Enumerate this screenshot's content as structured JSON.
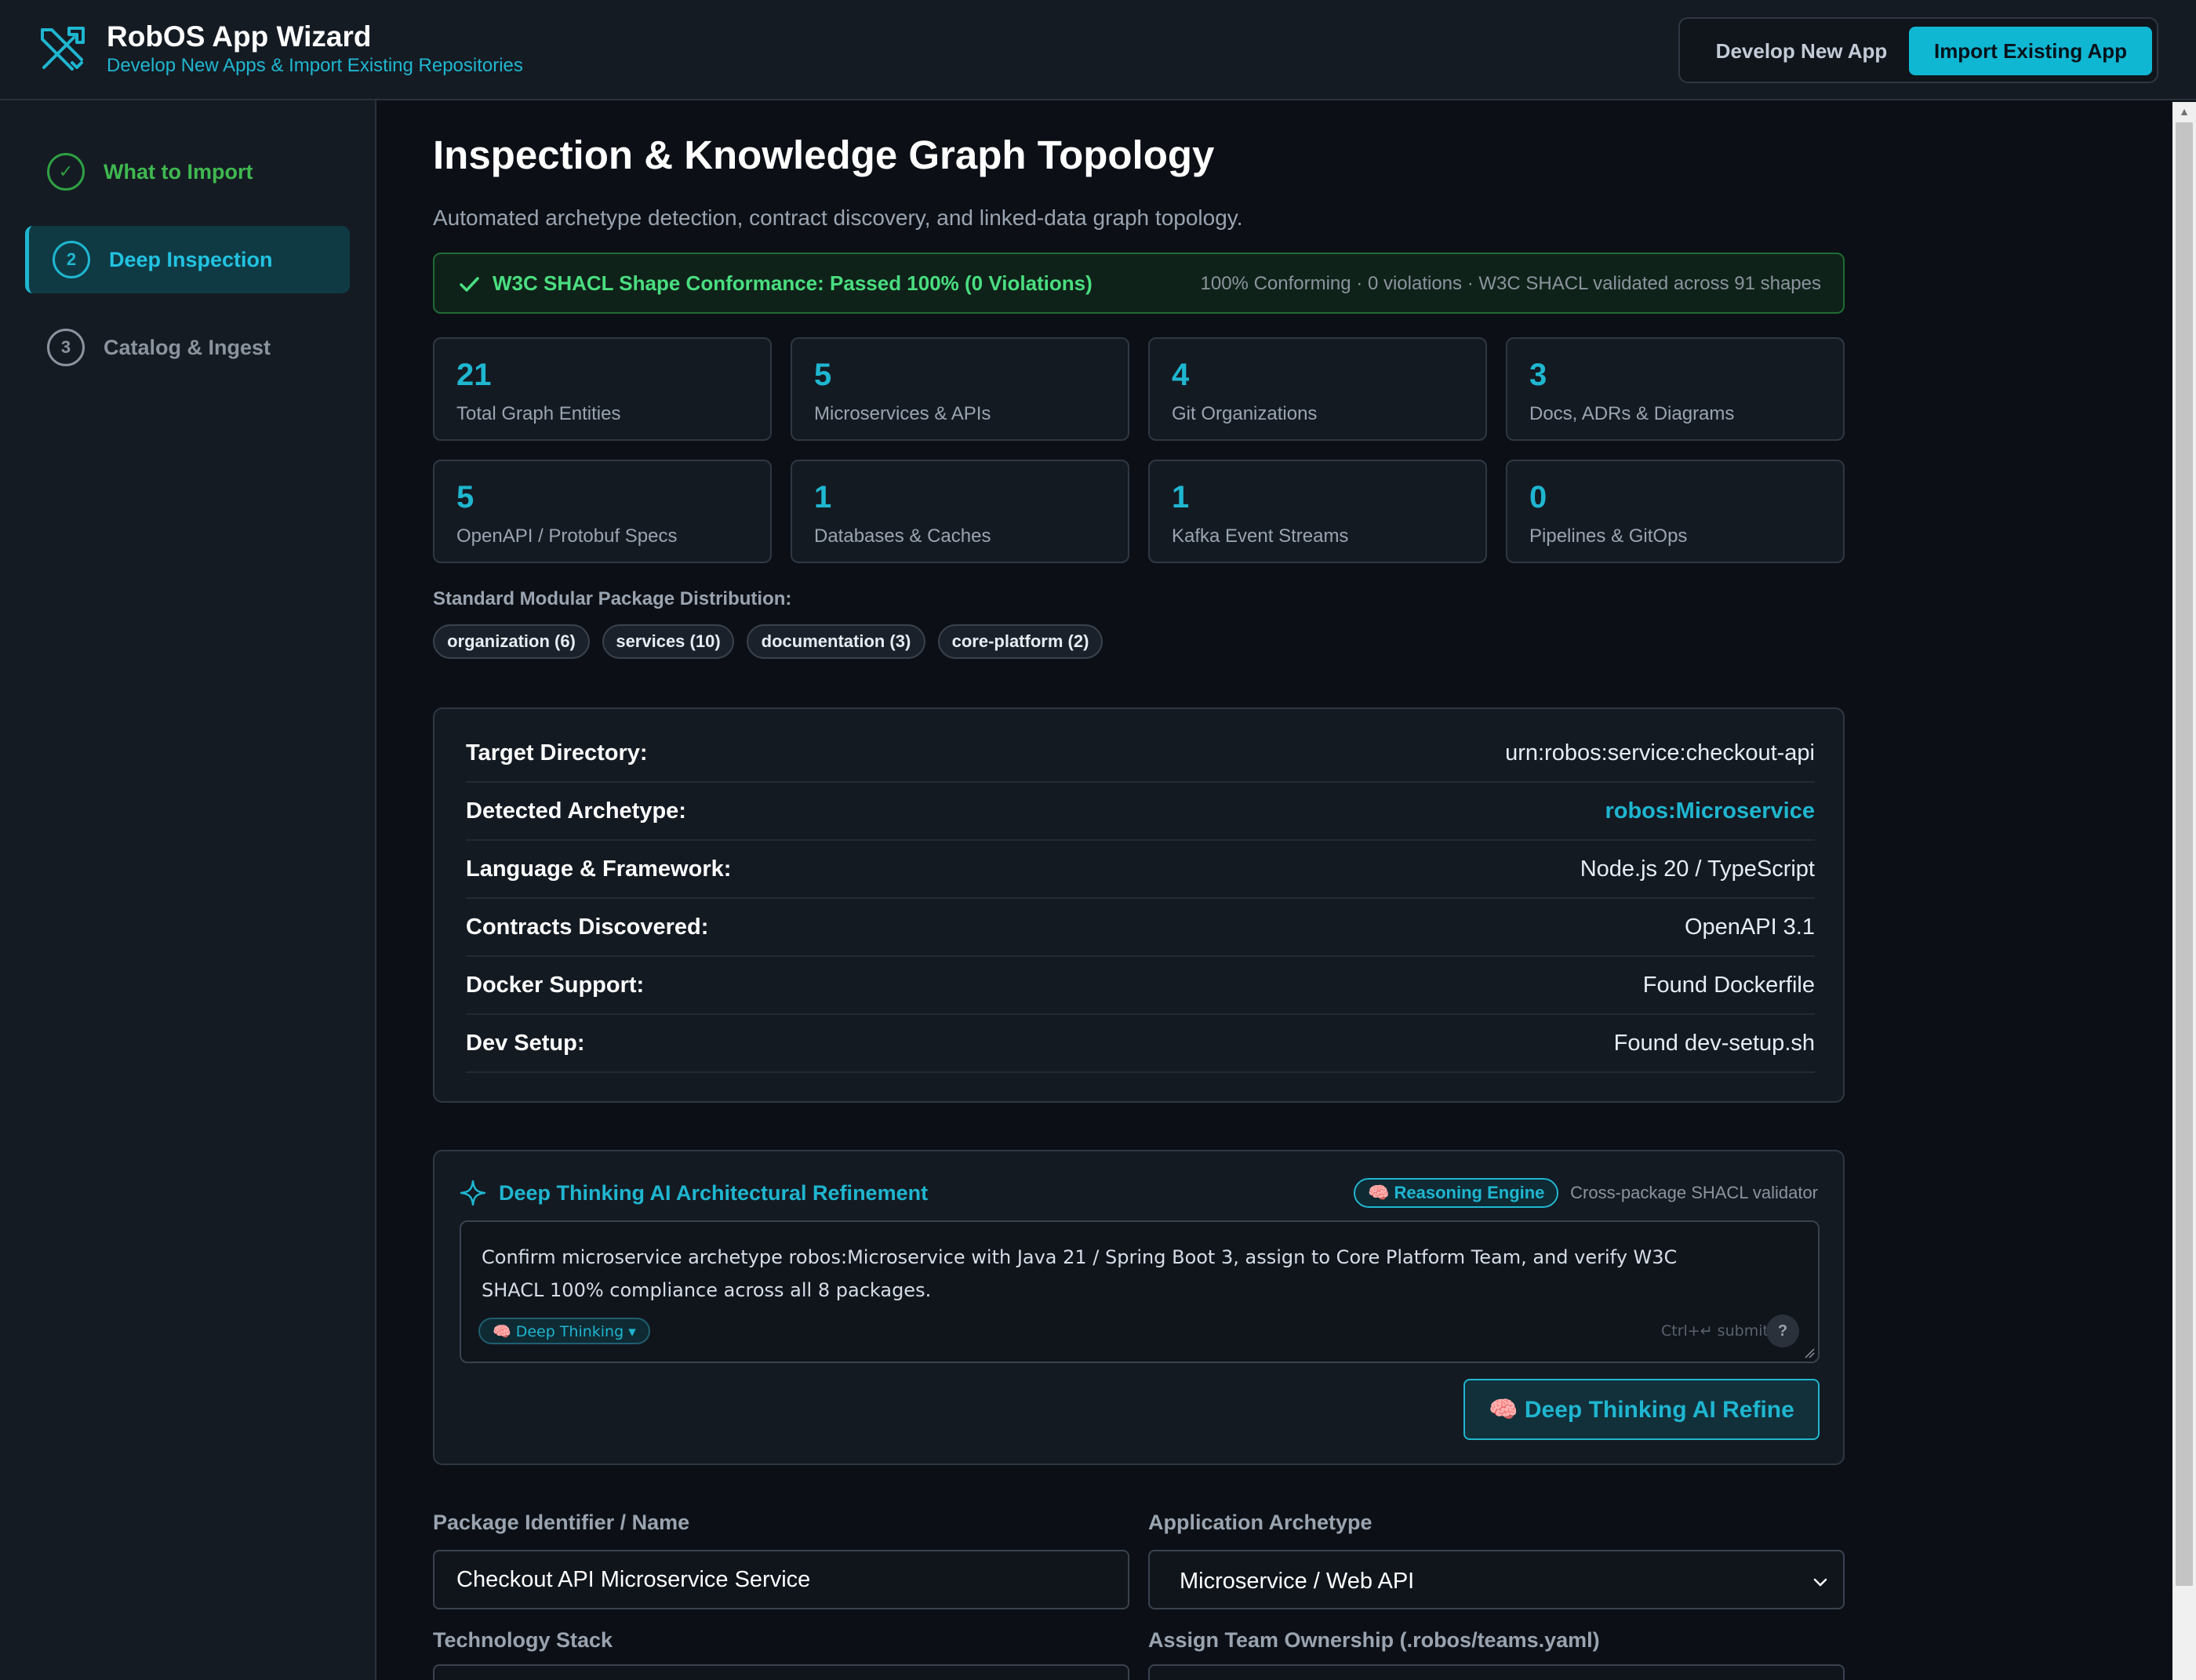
{
  "header": {
    "title": "RobOS App Wizard",
    "subtitle": "Develop New Apps & Import Existing Repositories",
    "logo_icon": "tools-cross-icon",
    "mode_develop_label": "Develop New App",
    "mode_import_label": "Import Existing App",
    "accent_color": "#10b7d3"
  },
  "sidebar": {
    "steps": [
      {
        "marker": "✓",
        "label": "What to Import",
        "state": "done"
      },
      {
        "marker": "2",
        "label": "Deep Inspection",
        "state": "active"
      },
      {
        "marker": "3",
        "label": "Catalog & Ingest",
        "state": "pending"
      }
    ]
  },
  "main": {
    "title": "Inspection & Knowledge Graph Topology",
    "description": "Automated archetype detection, contract discovery, and linked-data graph topology.",
    "shacl": {
      "status": "W3C SHACL Shape Conformance: Passed 100% (0 Violations)",
      "meta": "100% Conforming · 0 violations · W3C SHACL validated across 91 shapes",
      "color": "#4ade80"
    },
    "stats": [
      {
        "value": "21",
        "label": "Total Graph Entities"
      },
      {
        "value": "5",
        "label": "Microservices & APIs"
      },
      {
        "value": "4",
        "label": "Git Organizations"
      },
      {
        "value": "3",
        "label": "Docs, ADRs & Diagrams"
      },
      {
        "value": "5",
        "label": "OpenAPI / Protobuf Specs"
      },
      {
        "value": "1",
        "label": "Databases & Caches"
      },
      {
        "value": "1",
        "label": "Kafka Event Streams"
      },
      {
        "value": "0",
        "label": "Pipelines & GitOps"
      }
    ],
    "distribution": {
      "label": "Standard Modular Package Distribution:",
      "chips": [
        "organization (6)",
        "services (10)",
        "documentation (3)",
        "core-platform (2)"
      ]
    },
    "details": [
      {
        "key": "Target Directory:",
        "value": "urn:robos:service:checkout-api"
      },
      {
        "key": "Detected Archetype:",
        "value": "robos:Microservice"
      },
      {
        "key": "Language & Framework:",
        "value": "Node.js 20 / TypeScript"
      },
      {
        "key": "Contracts Discovered:",
        "value": "OpenAPI 3.1"
      },
      {
        "key": "Docker Support:",
        "value": "Found Dockerfile"
      },
      {
        "key": "Dev Setup:",
        "value": "Found dev-setup.sh"
      }
    ],
    "ai": {
      "title": "Deep Thinking AI Architectural Refinement",
      "engine_badge": "🧠 Reasoning Engine",
      "engine_meta": "Cross-package SHACL validator",
      "prompt": "Confirm microservice archetype robos:Microservice with Java 21 / Spring Boot 3, assign to Core Platform Team, and verify W3C SHACL 100% compliance across all 8 packages.",
      "mode_chip": "🧠 Deep Thinking ▾",
      "submit_hint": "Ctrl+↵ submit",
      "help_label": "?",
      "refine_label": "🧠  Deep Thinking AI Refine"
    },
    "form": {
      "package_label": "Package Identifier / Name",
      "package_value": "Checkout API Microservice Service",
      "archetype_label": "Application Archetype",
      "archetype_value": "Microservice / Web API",
      "tech_label": "Technology Stack",
      "team_label": "Assign Team Ownership (.robos/teams.yaml)"
    }
  }
}
